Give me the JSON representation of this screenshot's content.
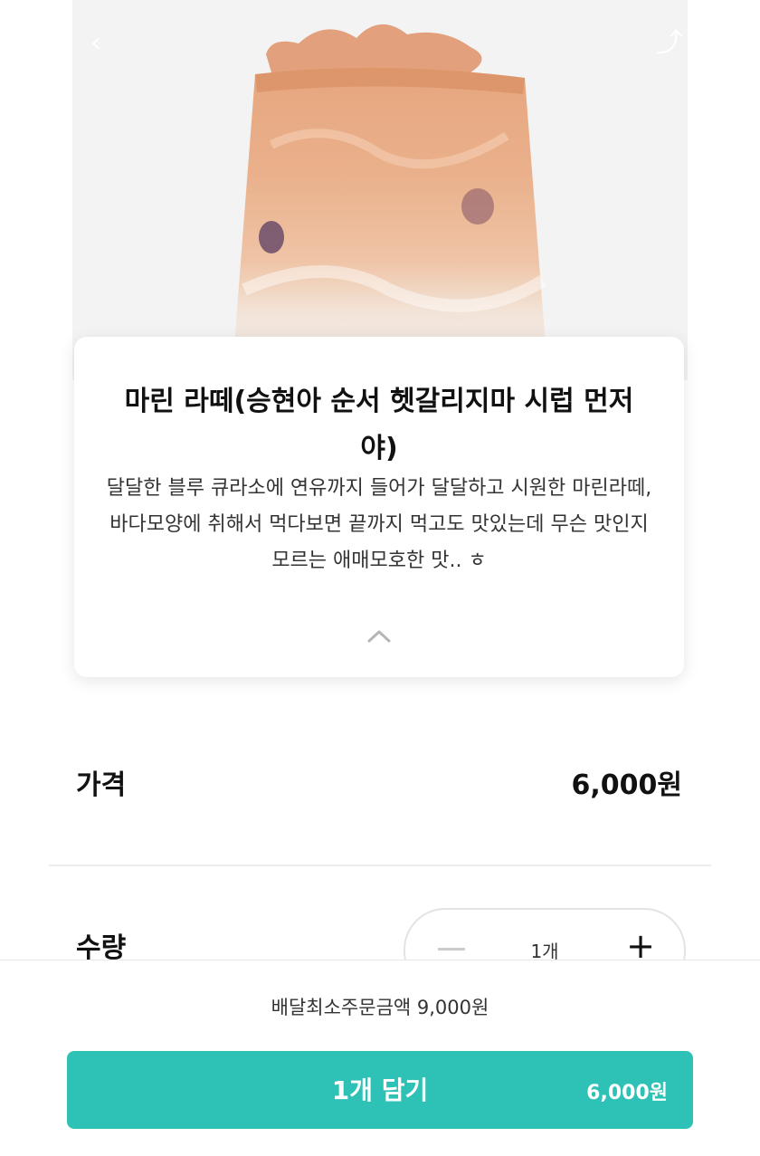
{
  "menu": {
    "title": "마린 라떼(승현아 순서 헷갈리지마 시럽 먼저야)",
    "description": "달달한 블루 큐라소에 연유까지 들어가 달달하고 시원한 마린라떼, 바다모양에 취해서 먹다보면 끝까지 먹고도 맛있는데 무슨 맛인지 모르는 애매모호한 맛.. ㅎ"
  },
  "price": {
    "label": "가격",
    "value": "6,000원"
  },
  "quantity": {
    "label": "수량",
    "value": "1개"
  },
  "footer": {
    "min_order": "배달최소주문금액 9,000원",
    "add_button_label": "1개 담기",
    "add_button_price": "6,000원"
  },
  "icons": {
    "back": "back-arrow-icon",
    "share": "share-icon",
    "collapse": "chevron-up-icon",
    "minus": "minus-icon",
    "plus": "plus-icon"
  },
  "colors": {
    "accent": "#2ec1b5",
    "drink_top": "#e0a27a",
    "drink_bottom": "#f1ece6"
  }
}
